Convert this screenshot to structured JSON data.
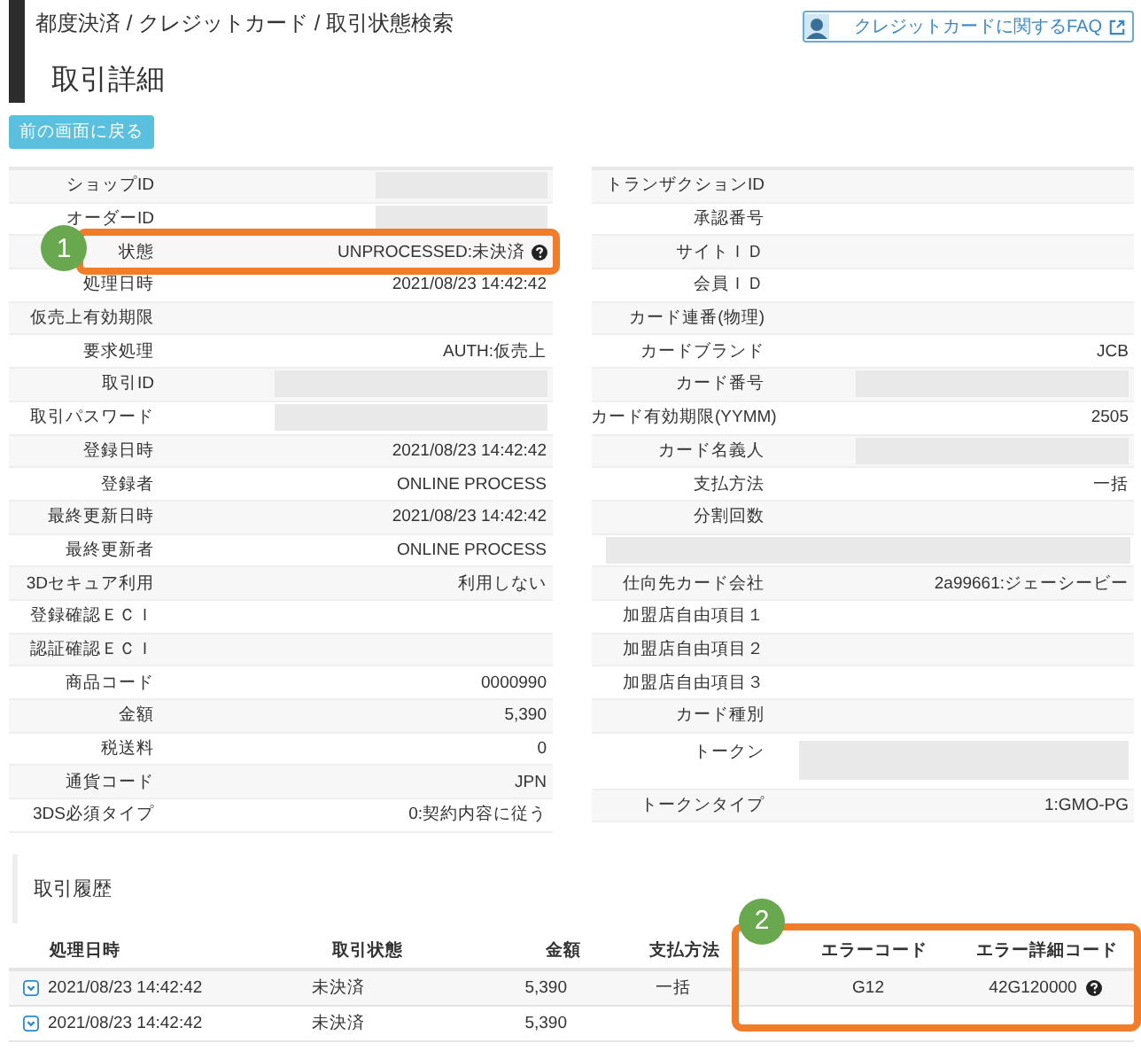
{
  "breadcrumb": "都度決済 / クレジットカード / 取引状態検索",
  "title": "取引詳細",
  "faq_link": "クレジットカードに関するFAQ",
  "back_button": "前の画面に戻る",
  "left_details": [
    {
      "label": "ショップID",
      "kind": "short_mask"
    },
    {
      "label": "オーダーID",
      "kind": "short_mask"
    },
    {
      "label": "状態",
      "value": "UNPROCESSED:未決済",
      "help": true,
      "callout": "1"
    },
    {
      "label": "処理日時",
      "value": "2021/08/23 14:42:42"
    },
    {
      "label": "仮売上有効期限"
    },
    {
      "label": "要求処理",
      "value": "AUTH:仮売上"
    },
    {
      "label": "取引ID",
      "kind": "mask"
    },
    {
      "label": "取引パスワード",
      "kind": "mask"
    },
    {
      "label": "登録日時",
      "value": "2021/08/23 14:42:42"
    },
    {
      "label": "登録者",
      "value": "ONLINE PROCESS"
    },
    {
      "label": "最終更新日時",
      "value": "2021/08/23 14:42:42"
    },
    {
      "label": "最終更新者",
      "value": "ONLINE PROCESS"
    },
    {
      "label": "3Dセキュア利用",
      "value": "利用しない"
    },
    {
      "label": "登録確認ＥＣＩ"
    },
    {
      "label": "認証確認ＥＣＩ"
    },
    {
      "label": "商品コード",
      "value": "0000990"
    },
    {
      "label": "金額",
      "value": "5,390"
    },
    {
      "label": "税送料",
      "value": "0"
    },
    {
      "label": "通貨コード",
      "value": "JPN"
    },
    {
      "label": "3DS必須タイプ",
      "value": "0:契約内容に従う"
    }
  ],
  "right_details": [
    {
      "label": "トランザクションID"
    },
    {
      "label": "承認番号"
    },
    {
      "label": "サイトＩＤ"
    },
    {
      "label": "会員ＩＤ"
    },
    {
      "label": "カード連番(物理)"
    },
    {
      "label": "カードブランド",
      "value": "JCB"
    },
    {
      "label": "カード番号",
      "kind": "mask"
    },
    {
      "label": "カード有効期限(YYMM)",
      "value": "2505"
    },
    {
      "label": "カード名義人",
      "kind": "mask"
    },
    {
      "label": "支払方法",
      "value": "一括"
    },
    {
      "label": "分割回数"
    },
    {
      "kind": "row_mask"
    },
    {
      "label": "仕向先カード会社",
      "value": "2a99661:ジェーシービー"
    },
    {
      "label": "加盟店自由項目１"
    },
    {
      "label": "加盟店自由項目２"
    },
    {
      "label": "加盟店自由項目３"
    },
    {
      "label": "カード種別"
    },
    {
      "label": "トークン",
      "kind": "tall_mask"
    },
    {
      "label": "トークンタイプ",
      "value": "1:GMO-PG"
    }
  ],
  "history": {
    "title": "取引履歴",
    "callout": "2",
    "columns": [
      "処理日時",
      "取引状態",
      "金額",
      "支払方法",
      "エラーコード",
      "エラー詳細コード"
    ],
    "rows": [
      {
        "date": "2021/08/23 14:42:42",
        "status": "未決済",
        "amount": "5,390",
        "method": "一括",
        "error_code": "G12",
        "error_detail": "42G120000",
        "help": true
      },
      {
        "date": "2021/08/23 14:42:42",
        "status": "未決済",
        "amount": "5,390"
      }
    ]
  }
}
